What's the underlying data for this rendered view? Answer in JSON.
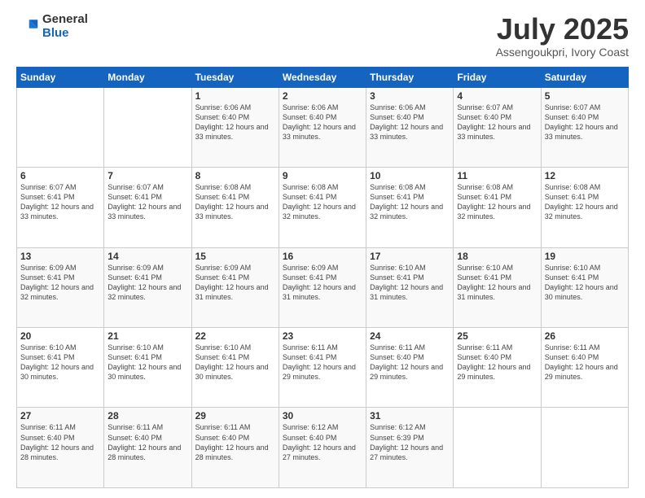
{
  "logo": {
    "general": "General",
    "blue": "Blue"
  },
  "header": {
    "month": "July 2025",
    "location": "Assengoukpri, Ivory Coast"
  },
  "weekdays": [
    "Sunday",
    "Monday",
    "Tuesday",
    "Wednesday",
    "Thursday",
    "Friday",
    "Saturday"
  ],
  "weeks": [
    [
      {
        "day": "",
        "info": ""
      },
      {
        "day": "",
        "info": ""
      },
      {
        "day": "1",
        "info": "Sunrise: 6:06 AM\nSunset: 6:40 PM\nDaylight: 12 hours and 33 minutes."
      },
      {
        "day": "2",
        "info": "Sunrise: 6:06 AM\nSunset: 6:40 PM\nDaylight: 12 hours and 33 minutes."
      },
      {
        "day": "3",
        "info": "Sunrise: 6:06 AM\nSunset: 6:40 PM\nDaylight: 12 hours and 33 minutes."
      },
      {
        "day": "4",
        "info": "Sunrise: 6:07 AM\nSunset: 6:40 PM\nDaylight: 12 hours and 33 minutes."
      },
      {
        "day": "5",
        "info": "Sunrise: 6:07 AM\nSunset: 6:40 PM\nDaylight: 12 hours and 33 minutes."
      }
    ],
    [
      {
        "day": "6",
        "info": "Sunrise: 6:07 AM\nSunset: 6:41 PM\nDaylight: 12 hours and 33 minutes."
      },
      {
        "day": "7",
        "info": "Sunrise: 6:07 AM\nSunset: 6:41 PM\nDaylight: 12 hours and 33 minutes."
      },
      {
        "day": "8",
        "info": "Sunrise: 6:08 AM\nSunset: 6:41 PM\nDaylight: 12 hours and 33 minutes."
      },
      {
        "day": "9",
        "info": "Sunrise: 6:08 AM\nSunset: 6:41 PM\nDaylight: 12 hours and 32 minutes."
      },
      {
        "day": "10",
        "info": "Sunrise: 6:08 AM\nSunset: 6:41 PM\nDaylight: 12 hours and 32 minutes."
      },
      {
        "day": "11",
        "info": "Sunrise: 6:08 AM\nSunset: 6:41 PM\nDaylight: 12 hours and 32 minutes."
      },
      {
        "day": "12",
        "info": "Sunrise: 6:08 AM\nSunset: 6:41 PM\nDaylight: 12 hours and 32 minutes."
      }
    ],
    [
      {
        "day": "13",
        "info": "Sunrise: 6:09 AM\nSunset: 6:41 PM\nDaylight: 12 hours and 32 minutes."
      },
      {
        "day": "14",
        "info": "Sunrise: 6:09 AM\nSunset: 6:41 PM\nDaylight: 12 hours and 32 minutes."
      },
      {
        "day": "15",
        "info": "Sunrise: 6:09 AM\nSunset: 6:41 PM\nDaylight: 12 hours and 31 minutes."
      },
      {
        "day": "16",
        "info": "Sunrise: 6:09 AM\nSunset: 6:41 PM\nDaylight: 12 hours and 31 minutes."
      },
      {
        "day": "17",
        "info": "Sunrise: 6:10 AM\nSunset: 6:41 PM\nDaylight: 12 hours and 31 minutes."
      },
      {
        "day": "18",
        "info": "Sunrise: 6:10 AM\nSunset: 6:41 PM\nDaylight: 12 hours and 31 minutes."
      },
      {
        "day": "19",
        "info": "Sunrise: 6:10 AM\nSunset: 6:41 PM\nDaylight: 12 hours and 30 minutes."
      }
    ],
    [
      {
        "day": "20",
        "info": "Sunrise: 6:10 AM\nSunset: 6:41 PM\nDaylight: 12 hours and 30 minutes."
      },
      {
        "day": "21",
        "info": "Sunrise: 6:10 AM\nSunset: 6:41 PM\nDaylight: 12 hours and 30 minutes."
      },
      {
        "day": "22",
        "info": "Sunrise: 6:10 AM\nSunset: 6:41 PM\nDaylight: 12 hours and 30 minutes."
      },
      {
        "day": "23",
        "info": "Sunrise: 6:11 AM\nSunset: 6:41 PM\nDaylight: 12 hours and 29 minutes."
      },
      {
        "day": "24",
        "info": "Sunrise: 6:11 AM\nSunset: 6:40 PM\nDaylight: 12 hours and 29 minutes."
      },
      {
        "day": "25",
        "info": "Sunrise: 6:11 AM\nSunset: 6:40 PM\nDaylight: 12 hours and 29 minutes."
      },
      {
        "day": "26",
        "info": "Sunrise: 6:11 AM\nSunset: 6:40 PM\nDaylight: 12 hours and 29 minutes."
      }
    ],
    [
      {
        "day": "27",
        "info": "Sunrise: 6:11 AM\nSunset: 6:40 PM\nDaylight: 12 hours and 28 minutes."
      },
      {
        "day": "28",
        "info": "Sunrise: 6:11 AM\nSunset: 6:40 PM\nDaylight: 12 hours and 28 minutes."
      },
      {
        "day": "29",
        "info": "Sunrise: 6:11 AM\nSunset: 6:40 PM\nDaylight: 12 hours and 28 minutes."
      },
      {
        "day": "30",
        "info": "Sunrise: 6:12 AM\nSunset: 6:40 PM\nDaylight: 12 hours and 27 minutes."
      },
      {
        "day": "31",
        "info": "Sunrise: 6:12 AM\nSunset: 6:39 PM\nDaylight: 12 hours and 27 minutes."
      },
      {
        "day": "",
        "info": ""
      },
      {
        "day": "",
        "info": ""
      }
    ]
  ]
}
